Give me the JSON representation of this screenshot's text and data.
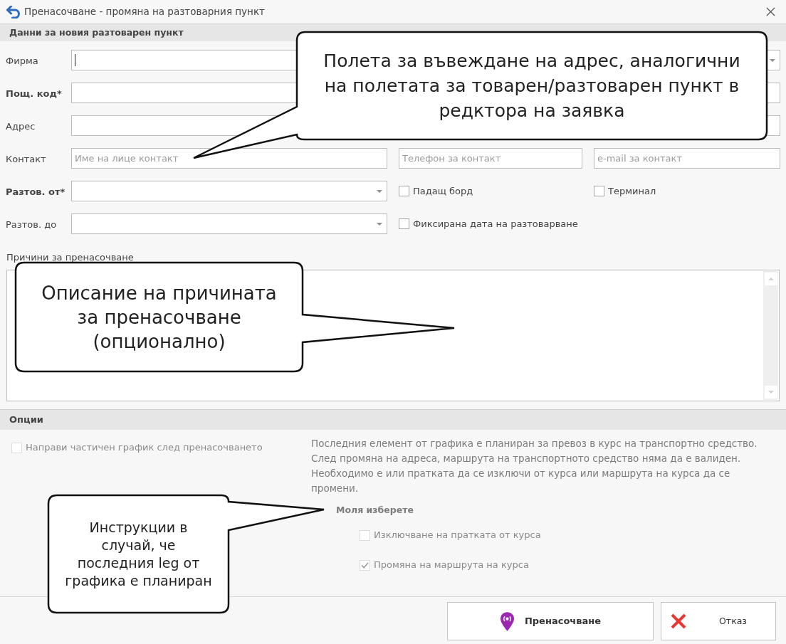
{
  "window": {
    "title": "Пренасочване - промяна на разтоварния пункт"
  },
  "delivery_section": {
    "title": "Данни за новия разтоварен пункт",
    "rows": [
      {
        "label": "Фирма",
        "required": false,
        "fields": [
          {
            "kind": "dropdown",
            "focused": true
          }
        ]
      },
      {
        "label": "Пощ. код*",
        "required": true,
        "fields": [
          {
            "kind": "text",
            "focused": false
          }
        ]
      },
      {
        "label": "Адрес",
        "required": false,
        "fields": [
          {
            "kind": "text",
            "focused": false
          }
        ]
      },
      {
        "label": "Контакт",
        "required": false,
        "fields": [
          {
            "kind": "text",
            "focused": false,
            "placeholder": "Име на лице контакт"
          },
          {
            "kind": "text",
            "focused": false,
            "placeholder": "Телефон за контакт"
          },
          {
            "kind": "text",
            "focused": false,
            "placeholder": "e-mail за контакт"
          }
        ]
      },
      {
        "label": "Разтов. от*",
        "required": true,
        "fields": [
          {
            "kind": "dropdown",
            "focused": false
          },
          {
            "kind": "checkbox",
            "label": "Падащ борд",
            "checked": false
          },
          {
            "kind": "checkbox",
            "label": "Терминал",
            "checked": false
          }
        ]
      },
      {
        "label": "Разтов. до",
        "required": false,
        "fields": [
          {
            "kind": "dropdown",
            "focused": false
          },
          {
            "kind": "checkbox",
            "label": "Фиксирана дата на разтоварване",
            "checked": false
          }
        ]
      }
    ]
  },
  "reason": {
    "label": "Причини за пренасочване"
  },
  "options_section": {
    "title": "Опции",
    "partial_schedule": {
      "label": "Направи частичен график след пренасочването",
      "checked": false,
      "disabled": true
    },
    "notice": "Последния елемент от графика е планиран за превоз в курс на транспортно средство. След промяна на адреса, маршрута на транспортното средство няма да е валиден. Необходимо е или пратката да се изключи от курса или маршрута на курса да се промени.",
    "prompt": "Моля изберете",
    "choices": [
      {
        "label": "Изключване на пратката от курса",
        "checked": false,
        "disabled": true
      },
      {
        "label": "Промяна на маршрута на курса",
        "checked": true,
        "disabled": true
      }
    ]
  },
  "buttons": [
    {
      "label": "Пренасочване",
      "kind": "primary"
    },
    {
      "label": "Отказ",
      "kind": "cancel"
    }
  ],
  "callouts": [
    {
      "text": "Полета за въвеждане на адрес, аналогични\nна полетата за товарен/разтоварен пункт в\nредктора на заявка"
    },
    {
      "text": "Описание на причината\nза пренасочване\n(опционално)"
    },
    {
      "text": "Инструкции в\nслучай, че\nпоследния leg от\nграфика е планиран"
    }
  ]
}
